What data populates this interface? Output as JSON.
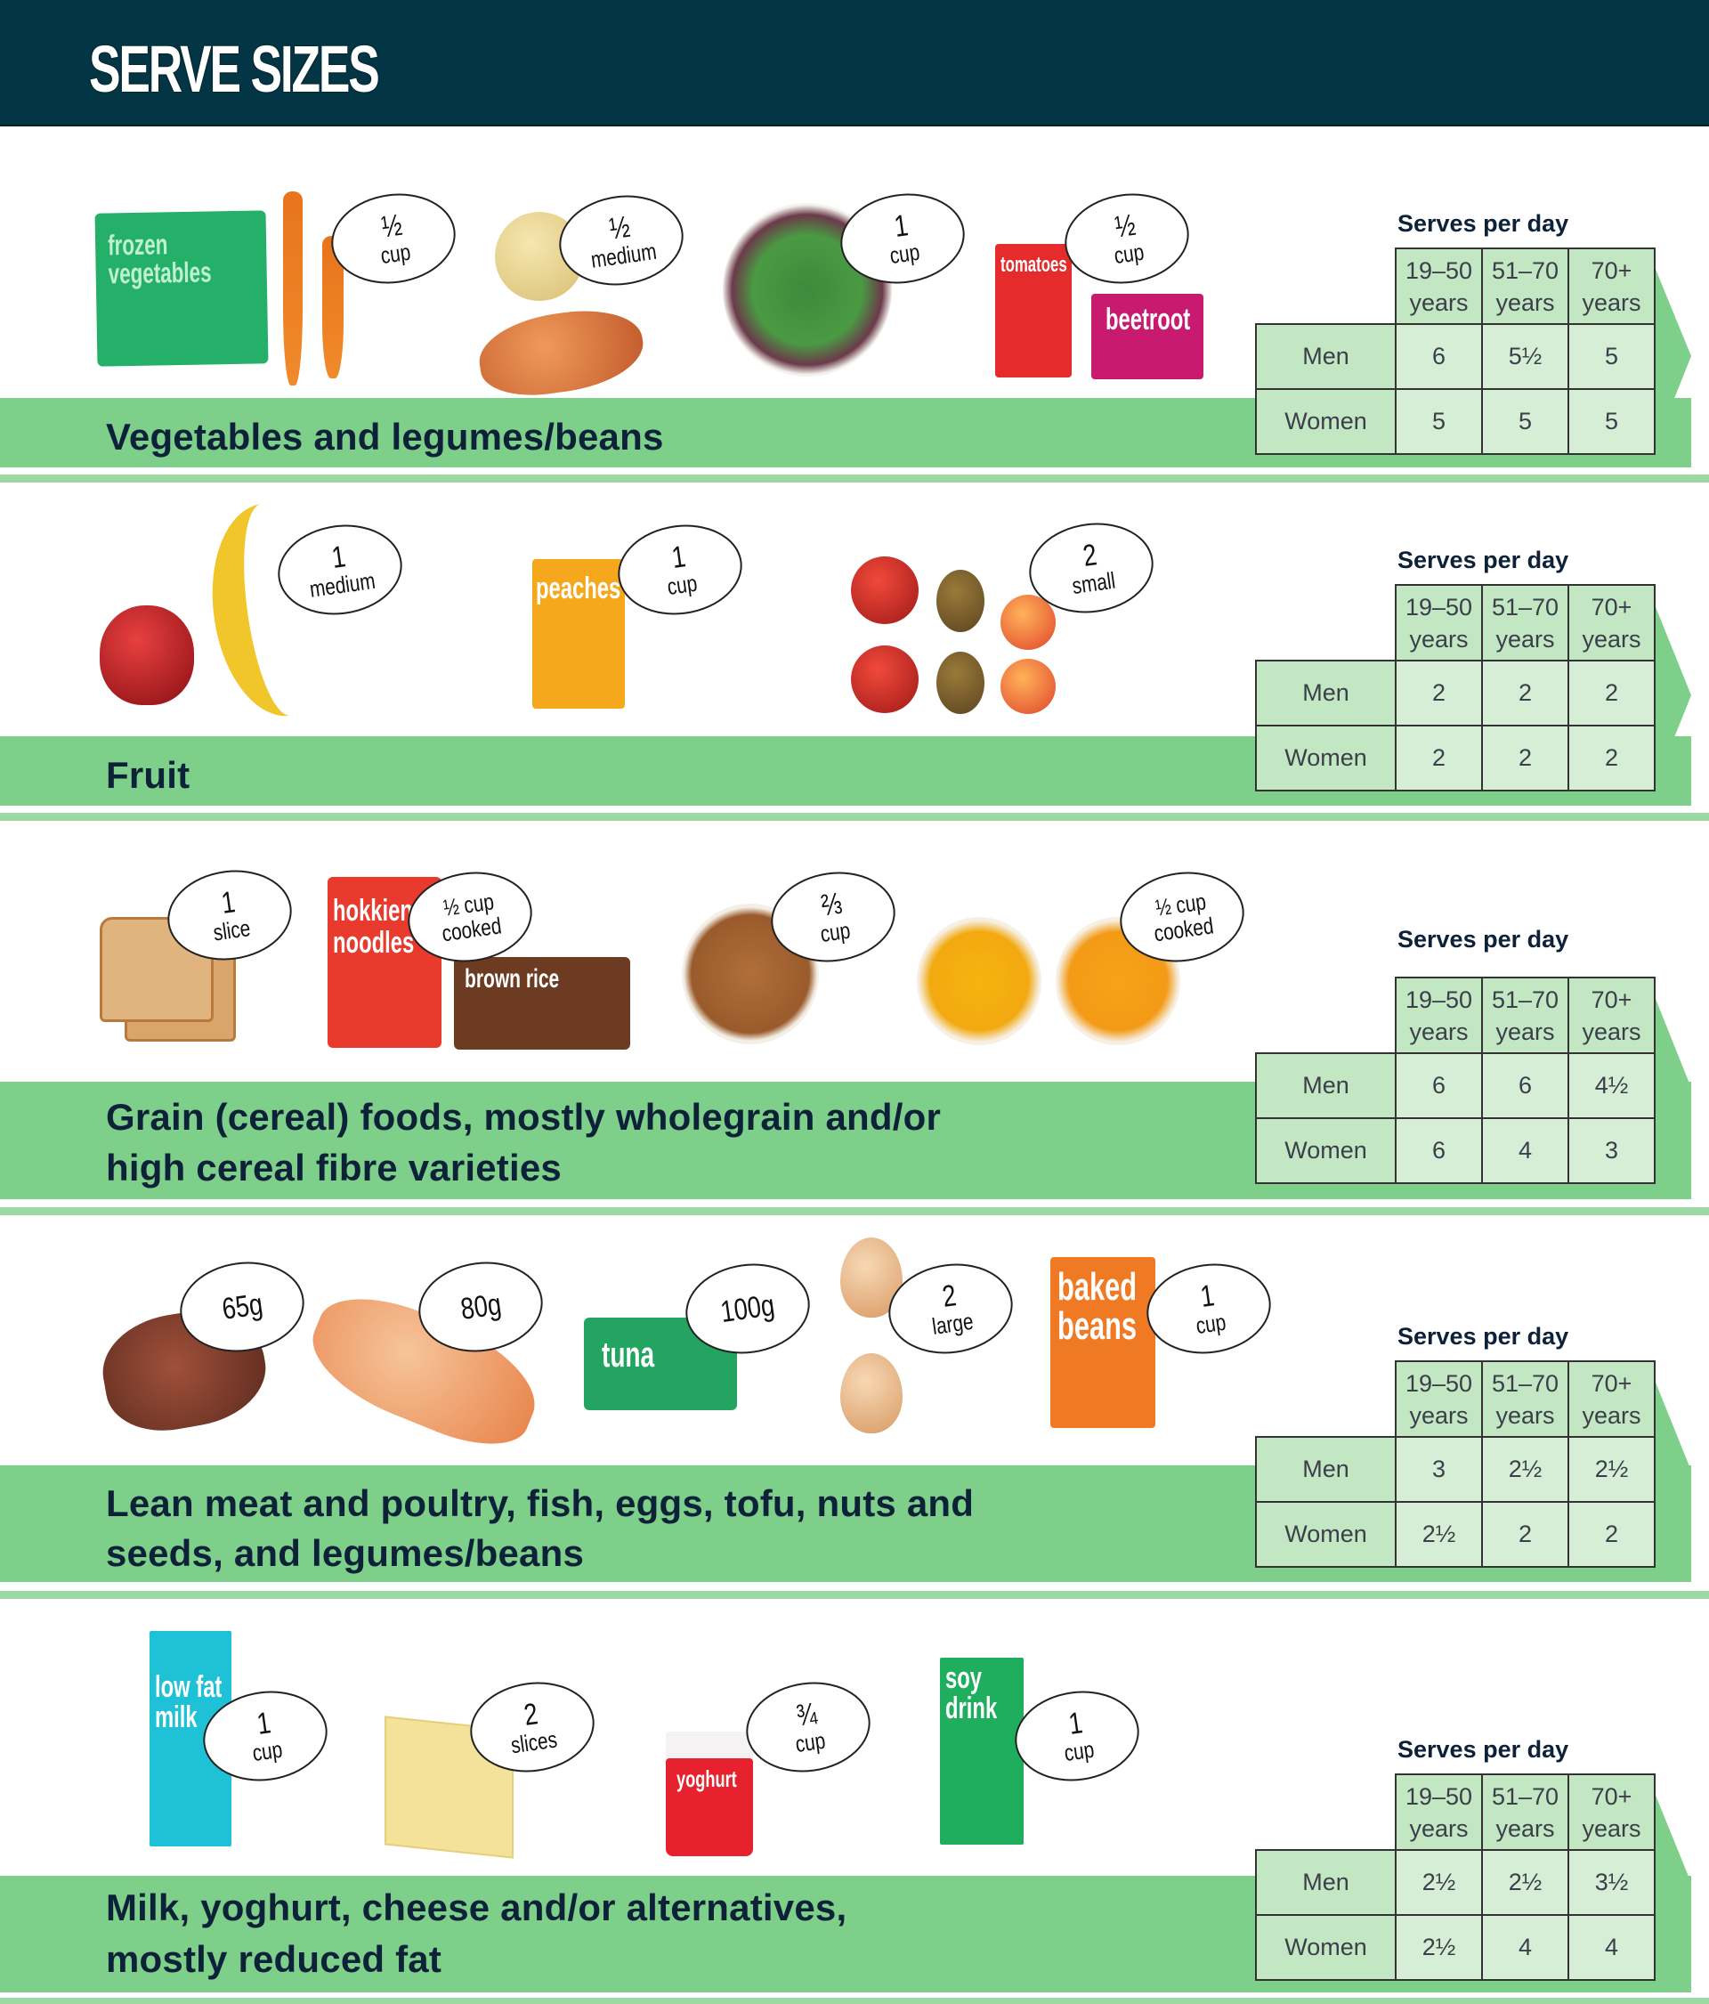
{
  "header": {
    "title": "SERVE SIZES"
  },
  "table_common": {
    "title": "Serves per day",
    "columns": [
      "19–50 years",
      "51–70 years",
      "70+ years"
    ],
    "columns_line1": [
      "19–50",
      "51–70",
      "70+"
    ],
    "columns_line2": [
      "years",
      "years",
      "years"
    ],
    "rows": [
      "Men",
      "Women"
    ]
  },
  "sections": [
    {
      "label_lines": [
        "Vegetables and legumes/beans"
      ],
      "foods": [
        {
          "item": "frozen vegetables / carrots",
          "pack_text": "frozen vegetables",
          "amount": "½",
          "unit": "cup"
        },
        {
          "item": "potato / sweet potato",
          "amount": "½",
          "unit": "medium"
        },
        {
          "item": "salad leaves",
          "amount": "1",
          "unit": "cup"
        },
        {
          "item": "tomatoes / beetroot cans",
          "pack_text": [
            "tomatoes",
            "beetroot"
          ],
          "amount": "½",
          "unit": "cup"
        }
      ],
      "serves": {
        "men": [
          "6",
          "5½",
          "5"
        ],
        "women": [
          "5",
          "5",
          "5"
        ]
      }
    },
    {
      "label_lines": [
        "Fruit"
      ],
      "foods": [
        {
          "item": "apple / banana",
          "amount": "1",
          "unit": "medium"
        },
        {
          "item": "peaches can",
          "pack_text": "peaches",
          "amount": "1",
          "unit": "cup"
        },
        {
          "item": "small fruits",
          "amount": "2",
          "unit": "small"
        }
      ],
      "serves": {
        "men": [
          "2",
          "2",
          "2"
        ],
        "women": [
          "2",
          "2",
          "2"
        ]
      }
    },
    {
      "label_lines": [
        "Grain (cereal) foods, mostly wholegrain and/or",
        "high cereal fibre varieties"
      ],
      "foods": [
        {
          "item": "bread",
          "amount": "1",
          "unit": "slice"
        },
        {
          "item": "hokkien noodles / brown rice",
          "pack_text": [
            "hokkien noodles",
            "brown rice"
          ],
          "amount": "½ cup",
          "unit": "cooked"
        },
        {
          "item": "cereal",
          "amount": "⅔",
          "unit": "cup"
        },
        {
          "item": "pasta",
          "amount": "½ cup",
          "unit": "cooked"
        }
      ],
      "serves": {
        "men": [
          "6",
          "6",
          "4½"
        ],
        "women": [
          "6",
          "4",
          "3"
        ]
      }
    },
    {
      "label_lines": [
        "Lean meat and poultry, fish, eggs, tofu, nuts and",
        "seeds, and legumes/beans"
      ],
      "foods": [
        {
          "item": "steak",
          "amount": "65g",
          "unit": ""
        },
        {
          "item": "chicken",
          "amount": "80g",
          "unit": ""
        },
        {
          "item": "tuna can",
          "pack_text": "tuna",
          "amount": "100g",
          "unit": ""
        },
        {
          "item": "eggs",
          "amount": "2",
          "unit": "large"
        },
        {
          "item": "baked beans can",
          "pack_text": "baked beans",
          "amount": "1",
          "unit": "cup"
        }
      ],
      "serves": {
        "men": [
          "3",
          "2½",
          "2½"
        ],
        "women": [
          "2½",
          "2",
          "2"
        ]
      }
    },
    {
      "label_lines": [
        "Milk, yoghurt, cheese and/or alternatives,",
        "mostly reduced fat"
      ],
      "foods": [
        {
          "item": "low fat milk",
          "pack_text": "low fat milk",
          "amount": "1",
          "unit": "cup"
        },
        {
          "item": "cheese",
          "amount": "2",
          "unit": "slices"
        },
        {
          "item": "yoghurt",
          "pack_text": "yoghurt",
          "amount": "¾",
          "unit": "cup"
        },
        {
          "item": "soy drink",
          "pack_text": "soy drink",
          "amount": "1",
          "unit": "cup"
        }
      ],
      "serves": {
        "men": [
          "2½",
          "2½",
          "3½"
        ],
        "women": [
          "2½",
          "4",
          "4"
        ]
      }
    }
  ],
  "colors": {
    "header_bg": "#033545",
    "bar_green": "#7ecf8a",
    "separator_green": "#9ad9a4",
    "table_header_cell": "#c3e6c3",
    "table_value_cell": "#d6eed6",
    "text_dark": "#0d2238"
  }
}
